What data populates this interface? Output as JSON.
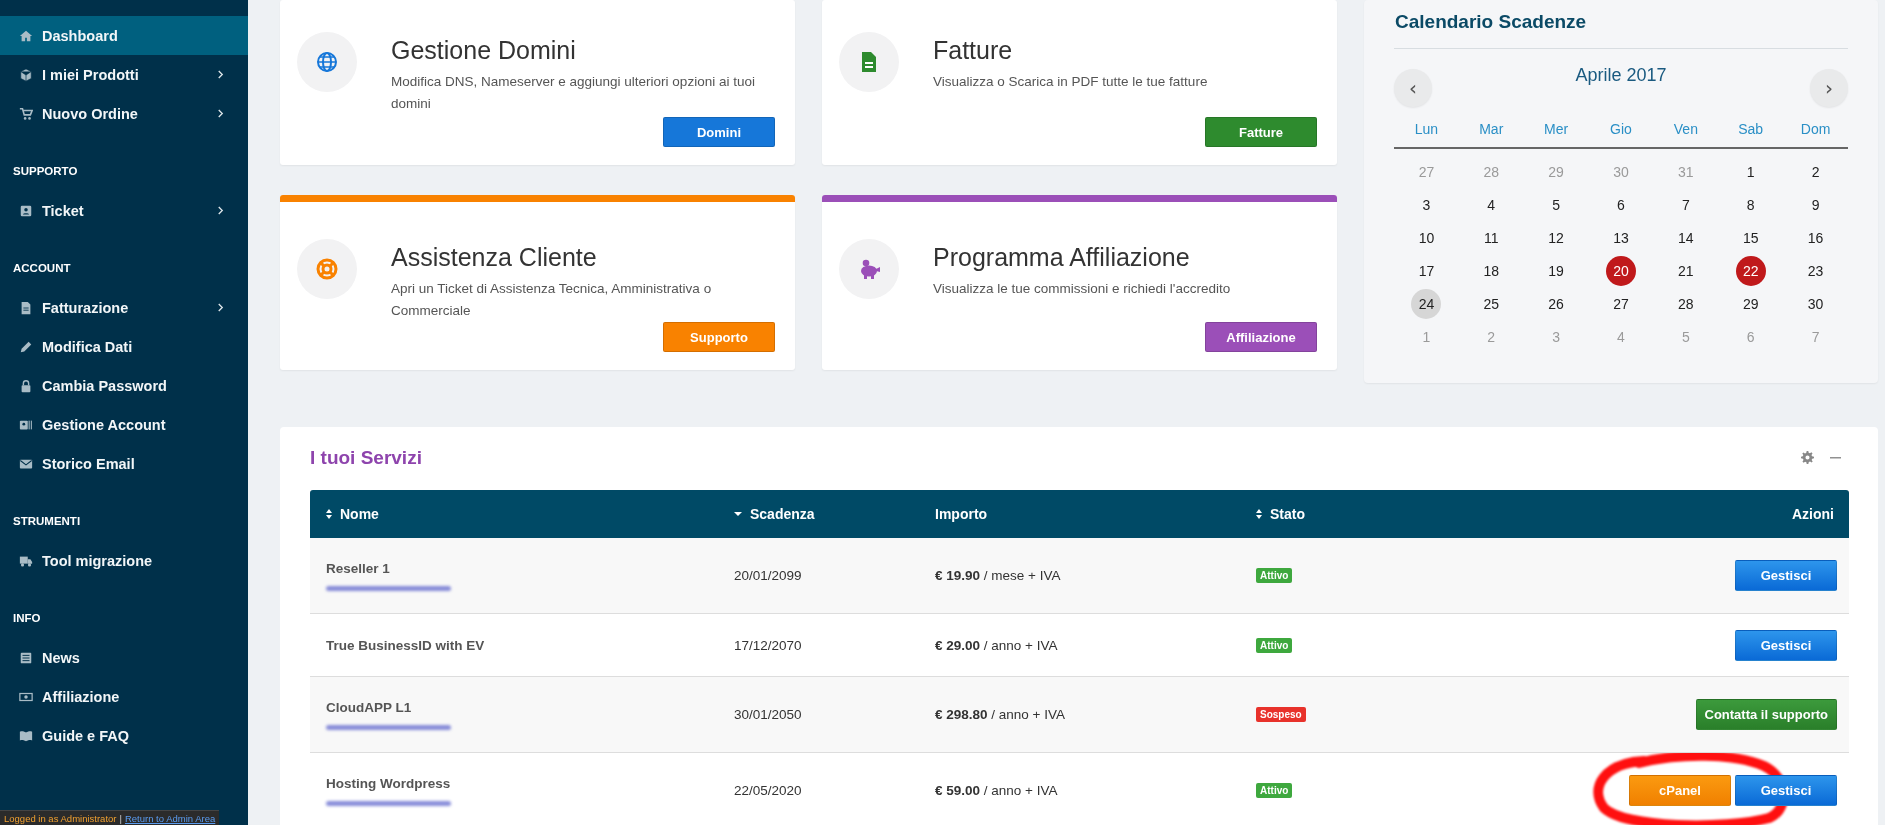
{
  "sidebar": {
    "sections": [
      {
        "items": [
          {
            "label": "Dashboard",
            "selected": true,
            "expandable": false
          },
          {
            "label": "I miei Prodotti",
            "selected": false,
            "expandable": true
          },
          {
            "label": "Nuovo Ordine",
            "selected": false,
            "expandable": true
          }
        ]
      },
      {
        "heading": "SUPPORTO",
        "items": [
          {
            "label": "Ticket",
            "selected": false,
            "expandable": true
          }
        ]
      },
      {
        "heading": "ACCOUNT",
        "items": [
          {
            "label": "Fatturazione",
            "selected": false,
            "expandable": true
          },
          {
            "label": "Modifica Dati",
            "selected": false,
            "expandable": false
          },
          {
            "label": "Cambia Password",
            "selected": false,
            "expandable": false
          },
          {
            "label": "Gestione Account",
            "selected": false,
            "expandable": false
          },
          {
            "label": "Storico Email",
            "selected": false,
            "expandable": false
          }
        ]
      },
      {
        "heading": "STRUMENTI",
        "items": [
          {
            "label": "Tool migrazione",
            "selected": false,
            "expandable": false
          }
        ]
      },
      {
        "heading": "INFO",
        "items": [
          {
            "label": "News",
            "selected": false,
            "expandable": false
          },
          {
            "label": "Affiliazione",
            "selected": false,
            "expandable": false
          },
          {
            "label": "Guide e FAQ",
            "selected": false,
            "expandable": false
          }
        ]
      }
    ]
  },
  "admin_bar": {
    "text": "Logged in as Administrator",
    "separator": "|",
    "link": "Return to Admin Area"
  },
  "cards": [
    {
      "title": "Gestione Domini",
      "description": "Modifica DNS, Nameserver e aggiungi ulteriori opzioni ai tuoi domini",
      "button": "Domini",
      "color": "#1677d9",
      "accent_bar": false
    },
    {
      "title": "Fatture",
      "description": "Visualizza o Scarica in PDF tutte le tue fatture",
      "button": "Fatture",
      "color": "#2e8b2e",
      "accent_bar": false
    },
    {
      "title": "Assistenza Cliente",
      "description": "Apri un Ticket di Assistenza Tecnica, Amministrativa o Commerciale",
      "button": "Supporto",
      "color": "#f98200",
      "accent_bar": true
    },
    {
      "title": "Programma Affiliazione",
      "description": "Visualizza le tue commissioni e richiedi l'accredito",
      "button": "Affiliazione",
      "color": "#9b4fb8",
      "accent_bar": true
    }
  ],
  "calendar": {
    "title": "Calendario Scadenze",
    "prev": "‹",
    "next": "›",
    "month": "Aprile 2017",
    "weekdays": [
      "Lun",
      "Mar",
      "Mer",
      "Gio",
      "Ven",
      "Sab",
      "Dom"
    ],
    "weeks": [
      [
        {
          "day": "27",
          "outside": true,
          "marked": false,
          "today": false
        },
        {
          "day": "28",
          "outside": true,
          "marked": false,
          "today": false
        },
        {
          "day": "29",
          "outside": true,
          "marked": false,
          "today": false
        },
        {
          "day": "30",
          "outside": true,
          "marked": false,
          "today": false
        },
        {
          "day": "31",
          "outside": true,
          "marked": false,
          "today": false
        },
        {
          "day": "1",
          "outside": false,
          "marked": false,
          "today": false
        },
        {
          "day": "2",
          "outside": false,
          "marked": false,
          "today": false
        }
      ],
      [
        {
          "day": "3",
          "outside": false,
          "marked": false,
          "today": false
        },
        {
          "day": "4",
          "outside": false,
          "marked": false,
          "today": false
        },
        {
          "day": "5",
          "outside": false,
          "marked": false,
          "today": false
        },
        {
          "day": "6",
          "outside": false,
          "marked": false,
          "today": false
        },
        {
          "day": "7",
          "outside": false,
          "marked": false,
          "today": false
        },
        {
          "day": "8",
          "outside": false,
          "marked": false,
          "today": false
        },
        {
          "day": "9",
          "outside": false,
          "marked": false,
          "today": false
        }
      ],
      [
        {
          "day": "10",
          "outside": false,
          "marked": false,
          "today": false
        },
        {
          "day": "11",
          "outside": false,
          "marked": false,
          "today": false
        },
        {
          "day": "12",
          "outside": false,
          "marked": false,
          "today": false
        },
        {
          "day": "13",
          "outside": false,
          "marked": false,
          "today": false
        },
        {
          "day": "14",
          "outside": false,
          "marked": false,
          "today": false
        },
        {
          "day": "15",
          "outside": false,
          "marked": false,
          "today": false
        },
        {
          "day": "16",
          "outside": false,
          "marked": false,
          "today": false
        }
      ],
      [
        {
          "day": "17",
          "outside": false,
          "marked": false,
          "today": false
        },
        {
          "day": "18",
          "outside": false,
          "marked": false,
          "today": false
        },
        {
          "day": "19",
          "outside": false,
          "marked": false,
          "today": false
        },
        {
          "day": "20",
          "outside": false,
          "marked": true,
          "today": false
        },
        {
          "day": "21",
          "outside": false,
          "marked": false,
          "today": false
        },
        {
          "day": "22",
          "outside": false,
          "marked": true,
          "today": false
        },
        {
          "day": "23",
          "outside": false,
          "marked": false,
          "today": false
        }
      ],
      [
        {
          "day": "24",
          "outside": false,
          "marked": false,
          "today": true
        },
        {
          "day": "25",
          "outside": false,
          "marked": false,
          "today": false
        },
        {
          "day": "26",
          "outside": false,
          "marked": false,
          "today": false
        },
        {
          "day": "27",
          "outside": false,
          "marked": false,
          "today": false
        },
        {
          "day": "28",
          "outside": false,
          "marked": false,
          "today": false
        },
        {
          "day": "29",
          "outside": false,
          "marked": false,
          "today": false
        },
        {
          "day": "30",
          "outside": false,
          "marked": false,
          "today": false
        }
      ],
      [
        {
          "day": "1",
          "outside": true,
          "marked": false,
          "today": false
        },
        {
          "day": "2",
          "outside": true,
          "marked": false,
          "today": false
        },
        {
          "day": "3",
          "outside": true,
          "marked": false,
          "today": false
        },
        {
          "day": "4",
          "outside": true,
          "marked": false,
          "today": false
        },
        {
          "day": "5",
          "outside": true,
          "marked": false,
          "today": false
        },
        {
          "day": "6",
          "outside": true,
          "marked": false,
          "today": false
        },
        {
          "day": "7",
          "outside": true,
          "marked": false,
          "today": false
        }
      ]
    ]
  },
  "services": {
    "title": "I tuoi Servizi",
    "columns": [
      {
        "label": "Nome",
        "kind": "sortable"
      },
      {
        "label": "Scadenza",
        "kind": "sorted"
      },
      {
        "label": "Importo",
        "kind": "plain"
      },
      {
        "label": "Stato",
        "kind": "sortable"
      },
      {
        "label": "Azioni",
        "kind": "plain"
      }
    ],
    "rows": [
      {
        "name": "Reseller 1",
        "redacted": true,
        "expiry": "20/01/2099",
        "amount": "**€ 19.90** / mese + IVA",
        "status": {
          "label": "Attivo",
          "kind": "active"
        },
        "actions": [
          {
            "label": "Gestisci",
            "kind": "primary",
            "circled": false
          }
        ]
      },
      {
        "name": "True BusinessID with EV",
        "redacted": false,
        "expiry": "17/12/2070",
        "amount": "**€ 29.00** / anno + IVA",
        "status": {
          "label": "Attivo",
          "kind": "active"
        },
        "actions": [
          {
            "label": "Gestisci",
            "kind": "primary",
            "circled": false
          }
        ]
      },
      {
        "name": "CloudAPP L1",
        "redacted": true,
        "expiry": "30/01/2050",
        "amount": "**€ 298.80** / anno + IVA",
        "status": {
          "label": "Sospeso",
          "kind": "suspended"
        },
        "actions": [
          {
            "label": "Contatta il supporto",
            "kind": "success",
            "circled": false
          }
        ]
      },
      {
        "name": "Hosting Wordpress",
        "redacted": true,
        "expiry": "22/05/2020",
        "amount": "**€ 59.00** / anno + IVA",
        "status": {
          "label": "Attivo",
          "kind": "active"
        },
        "actions": [
          {
            "label": "cPanel",
            "kind": "warning",
            "circled": true
          },
          {
            "label": "Gestisci",
            "kind": "primary",
            "circled": false
          }
        ]
      }
    ]
  }
}
